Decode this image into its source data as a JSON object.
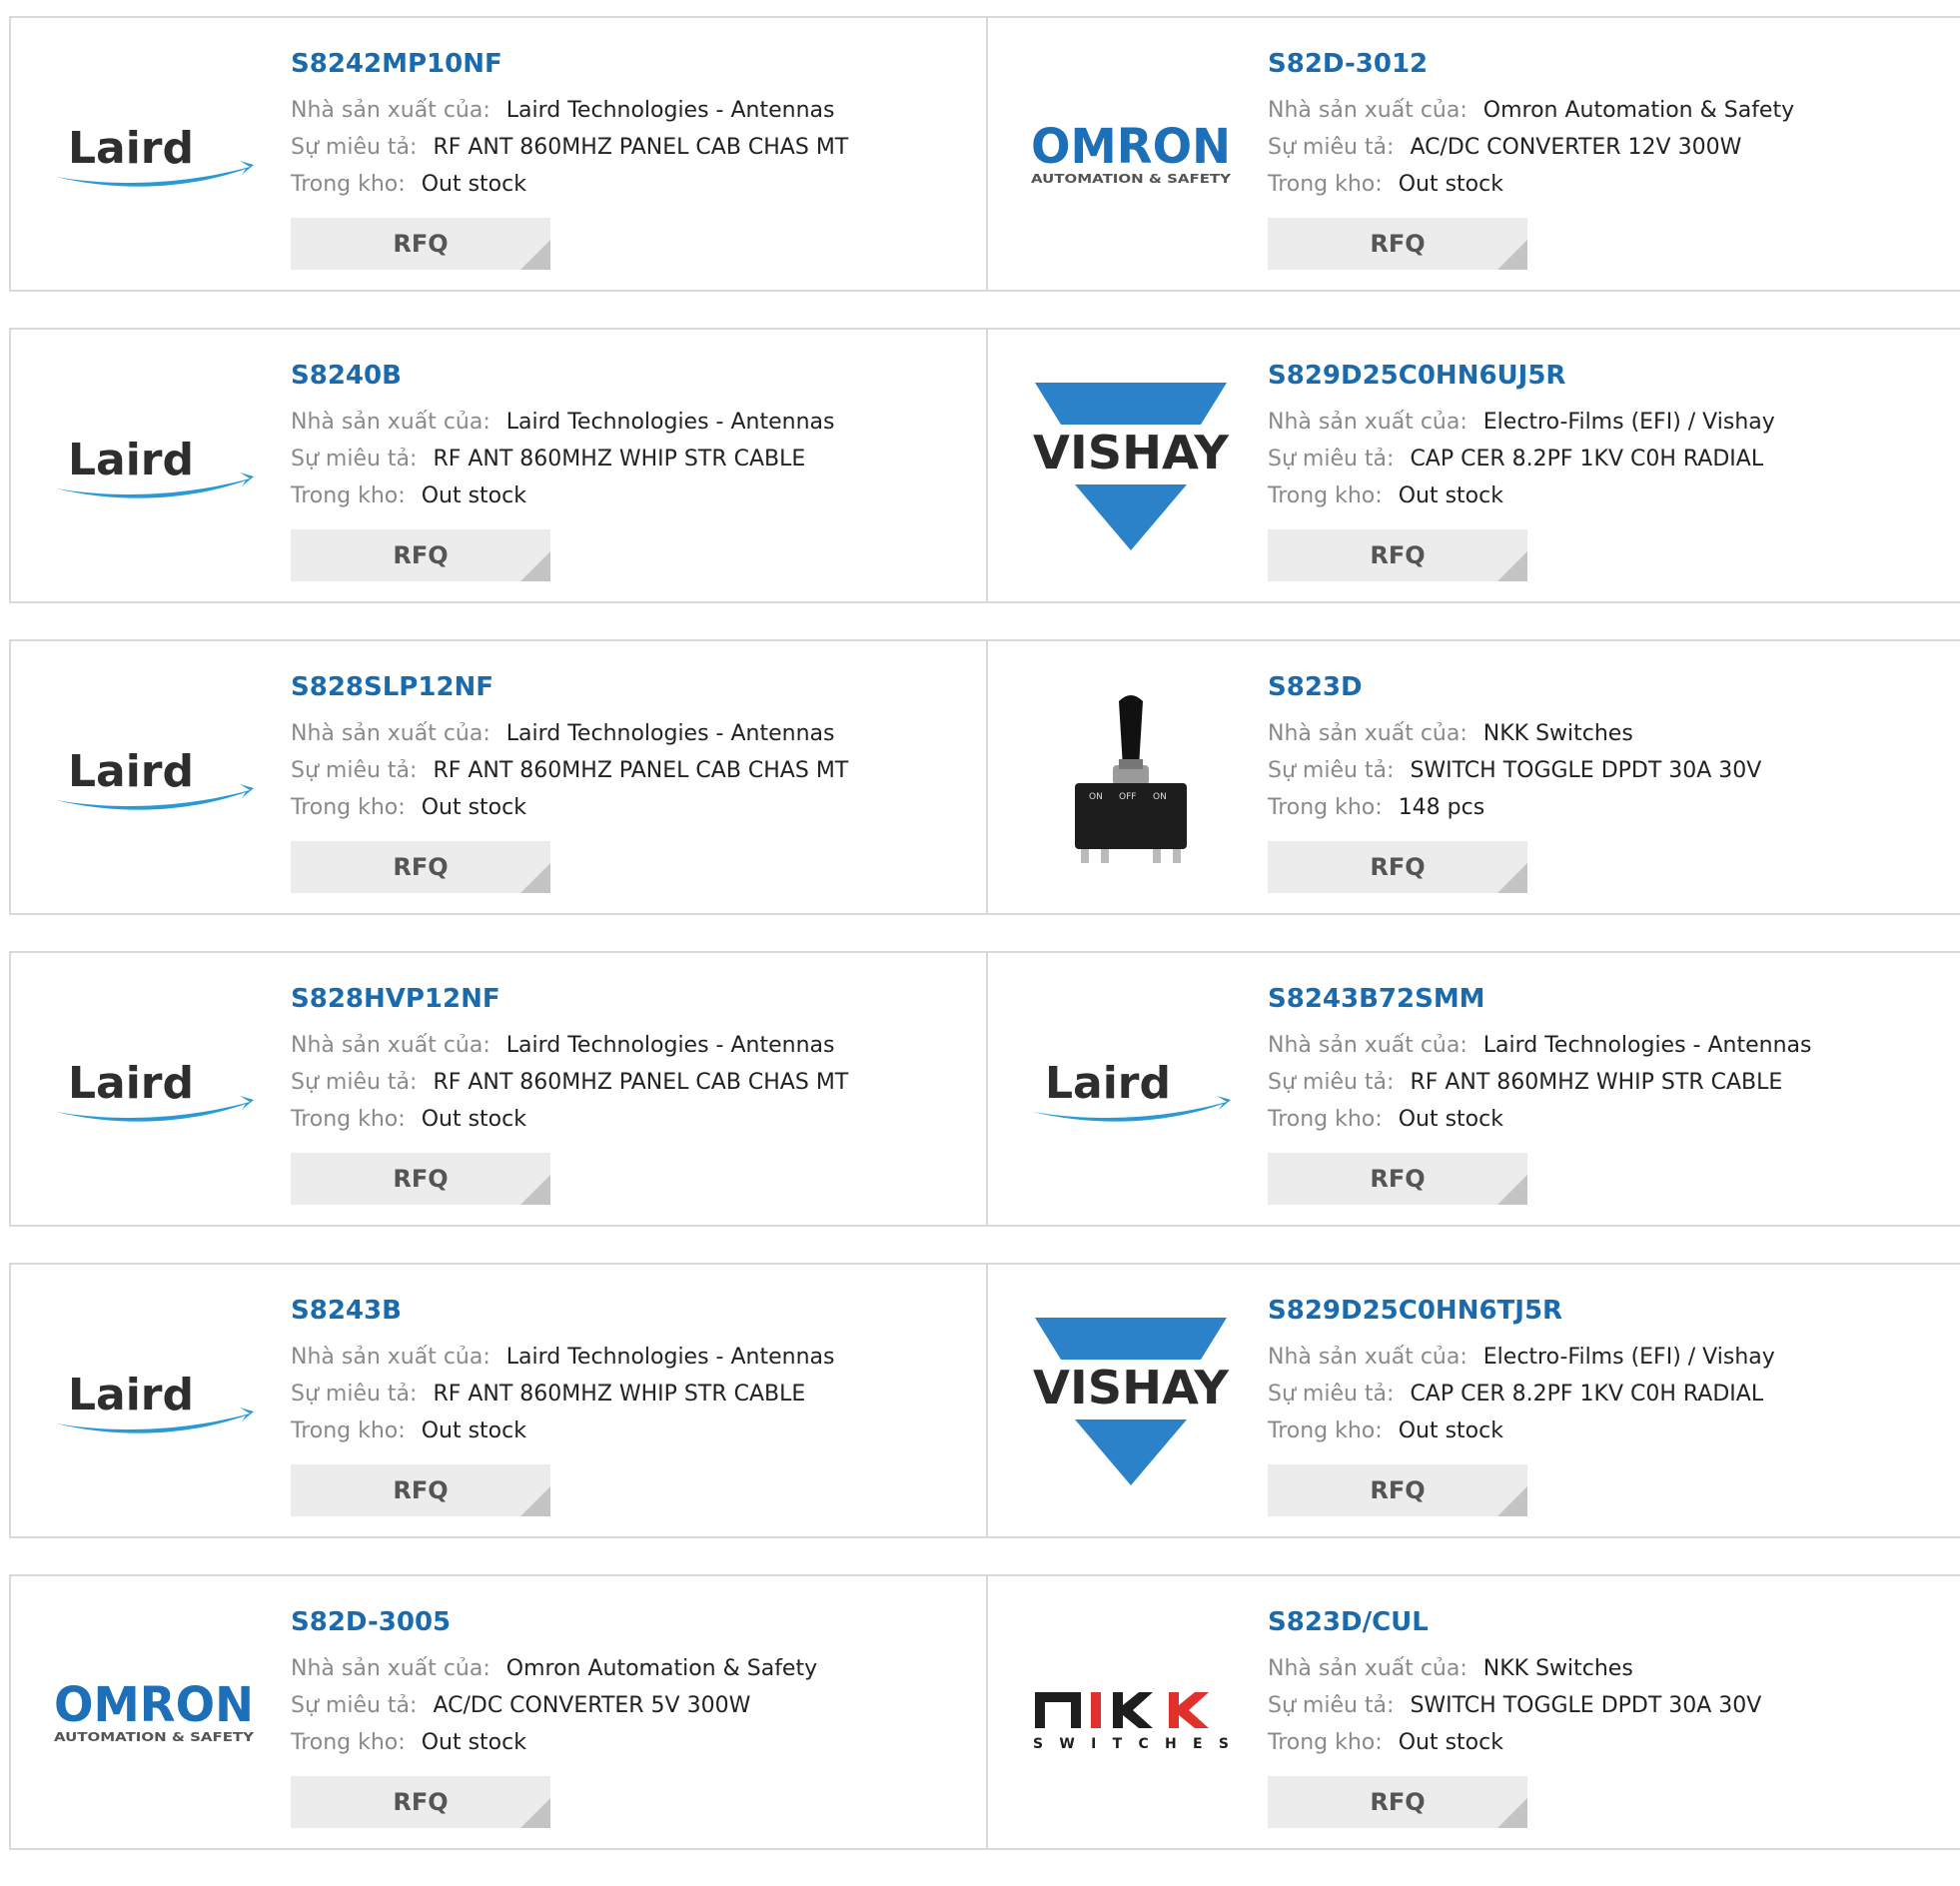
{
  "labels": {
    "manufacturer": "Nhà sản xuất của:",
    "description": "Sự miêu tả:",
    "stock": "Trong kho:",
    "rfq": "RFQ"
  },
  "brands": {
    "laird": "Laird",
    "omron": "OMRON",
    "omron_sub": "AUTOMATION & SAFETY",
    "vishay": "VISHAY",
    "nkk_sub": "SWITCHES",
    "switch_on": "ON",
    "switch_off": "OFF"
  },
  "colors": {
    "part_link": "#1a6aae",
    "vishay_blue": "#2b82c9",
    "omron_blue": "#1d6fb8",
    "laird_swoosh": "#2a9ad6"
  },
  "products": [
    {
      "part": "S8242MP10NF",
      "manufacturer": "Laird Technologies - Antennas",
      "description": "RF ANT 860MHZ PANEL CAB CHAS MT",
      "stock": "Out stock",
      "logo": "laird-logo"
    },
    {
      "part": "S82D-3012",
      "manufacturer": "Omron Automation & Safety",
      "description": "AC/DC CONVERTER 12V 300W",
      "stock": "Out stock",
      "logo": "omron-logo"
    },
    {
      "part": "S8240B",
      "manufacturer": "Laird Technologies - Antennas",
      "description": "RF ANT 860MHZ WHIP STR CABLE",
      "stock": "Out stock",
      "logo": "laird-logo"
    },
    {
      "part": "S829D25C0HN6UJ5R",
      "manufacturer": "Electro-Films (EFI) / Vishay",
      "description": "CAP CER 8.2PF 1KV C0H RADIAL",
      "stock": "Out stock",
      "logo": "vishay-logo"
    },
    {
      "part": "S828SLP12NF",
      "manufacturer": "Laird Technologies - Antennas",
      "description": "RF ANT 860MHZ PANEL CAB CHAS MT",
      "stock": "Out stock",
      "logo": "laird-logo"
    },
    {
      "part": "S823D",
      "manufacturer": "NKK Switches",
      "description": "SWITCH TOGGLE DPDT 30A 30V",
      "stock": "148 pcs",
      "logo": "toggle-switch-photo"
    },
    {
      "part": "S828HVP12NF",
      "manufacturer": "Laird Technologies - Antennas",
      "description": "RF ANT 860MHZ PANEL CAB CHAS MT",
      "stock": "Out stock",
      "logo": "laird-logo"
    },
    {
      "part": "S8243B72SMM",
      "manufacturer": "Laird Technologies - Antennas",
      "description": "RF ANT 860MHZ WHIP STR CABLE",
      "stock": "Out stock",
      "logo": "laird-logo"
    },
    {
      "part": "S8243B",
      "manufacturer": "Laird Technologies - Antennas",
      "description": "RF ANT 860MHZ WHIP STR CABLE",
      "stock": "Out stock",
      "logo": "laird-logo"
    },
    {
      "part": "S829D25C0HN6TJ5R",
      "manufacturer": "Electro-Films (EFI) / Vishay",
      "description": "CAP CER 8.2PF 1KV C0H RADIAL",
      "stock": "Out stock",
      "logo": "vishay-logo"
    },
    {
      "part": "S82D-3005",
      "manufacturer": "Omron Automation & Safety",
      "description": "AC/DC CONVERTER 5V 300W",
      "stock": "Out stock",
      "logo": "omron-logo"
    },
    {
      "part": "S823D/CUL",
      "manufacturer": "NKK Switches",
      "description": "SWITCH TOGGLE DPDT 30A 30V",
      "stock": "Out stock",
      "logo": "nkk-logo"
    }
  ]
}
